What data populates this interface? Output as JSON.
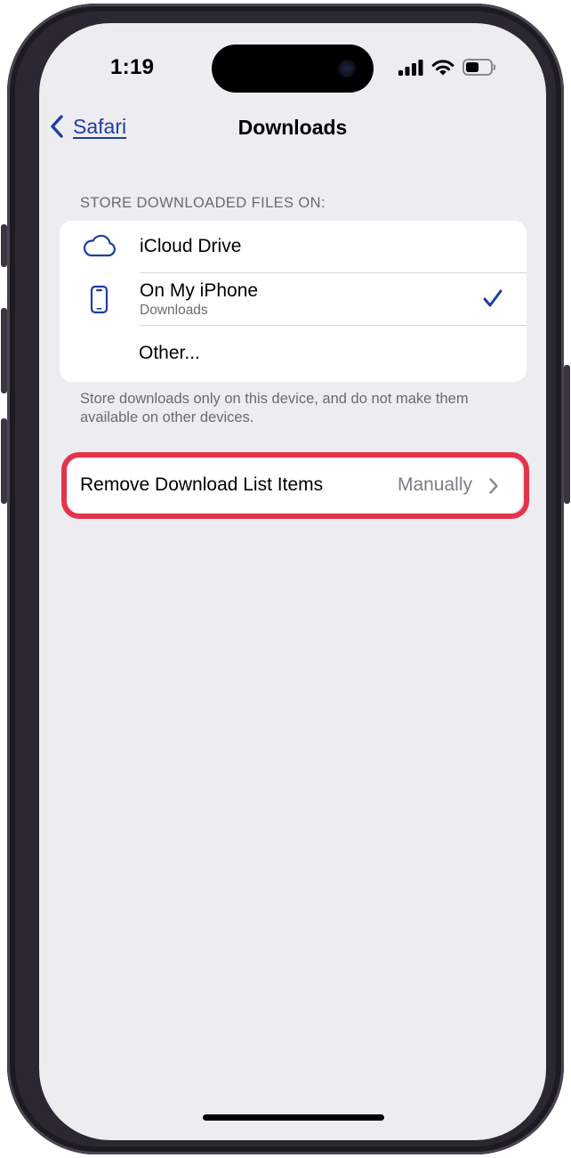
{
  "status_bar": {
    "time": "1:19",
    "signal_icon": "cellular-signal-icon",
    "wifi_icon": "wifi-icon",
    "battery_icon": "battery-icon"
  },
  "nav": {
    "back_label": "Safari",
    "title": "Downloads"
  },
  "storage": {
    "header": "STORE DOWNLOADED FILES ON:",
    "options": [
      {
        "label": "iCloud Drive",
        "icon": "cloud-icon",
        "selected": false
      },
      {
        "label": "On My iPhone",
        "sublabel": "Downloads",
        "icon": "iphone-icon",
        "selected": true
      },
      {
        "label": "Other...",
        "selected": false
      }
    ],
    "footer": "Store downloads only on this device, and do not make them available on other devices."
  },
  "remove_items": {
    "label": "Remove Download List Items",
    "value": "Manually"
  },
  "colors": {
    "accent": "#1d3f9e",
    "highlight": "#e3344b",
    "background": "#edecf1"
  }
}
